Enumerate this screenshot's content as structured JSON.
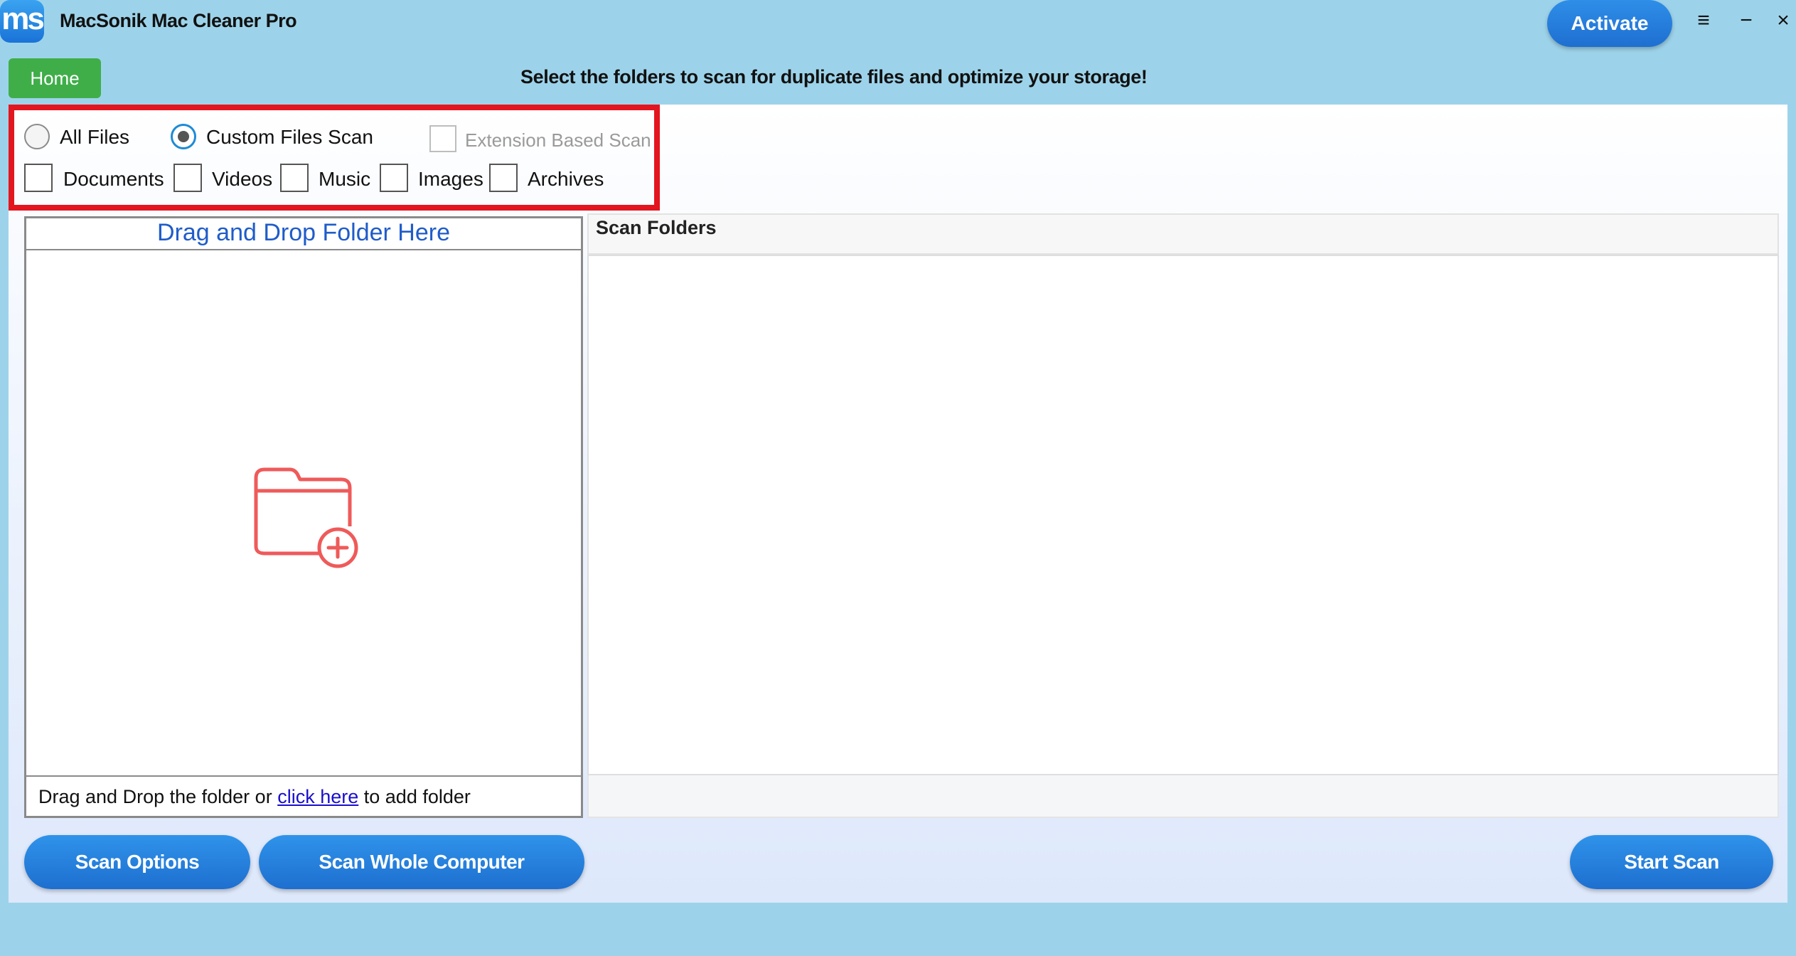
{
  "app": {
    "logo_text": "ms",
    "title": "MacSonik Mac Cleaner Pro",
    "activate_label": "Activate",
    "menu_glyph": "≡",
    "minimize_glyph": "−",
    "close_glyph": "×"
  },
  "nav": {
    "home_label": "Home"
  },
  "heading": "Select the folders to scan for duplicate files and optimize your storage!",
  "scan_mode": {
    "options": [
      {
        "label": "All Files",
        "selected": false
      },
      {
        "label": "Custom Files Scan",
        "selected": true
      }
    ],
    "extension_scan": {
      "label": "Extension Based Scan",
      "checked": false,
      "enabled": false
    }
  },
  "file_types": [
    {
      "label": "Documents",
      "checked": false
    },
    {
      "label": "Videos",
      "checked": false
    },
    {
      "label": "Music",
      "checked": false
    },
    {
      "label": "Images",
      "checked": false
    },
    {
      "label": "Archives",
      "checked": false
    }
  ],
  "dropzone": {
    "header": "Drag and Drop Folder Here",
    "icon": "folder-add-icon",
    "footer_prefix": "Drag and Drop the folder or",
    "footer_link": " click here",
    "footer_suffix": "to add folder"
  },
  "scan_folders": {
    "header": "Scan Folders",
    "items": []
  },
  "buttons": {
    "scan_options": "Scan Options",
    "scan_whole_computer": "Scan Whole Computer",
    "start_scan": "Start Scan"
  },
  "colors": {
    "background": "#9dd3ea",
    "accent_blue": "#1f6fd0",
    "home_green": "#3fae49",
    "highlight_red": "#e3151f",
    "folder_icon": "#ef5a5a"
  }
}
